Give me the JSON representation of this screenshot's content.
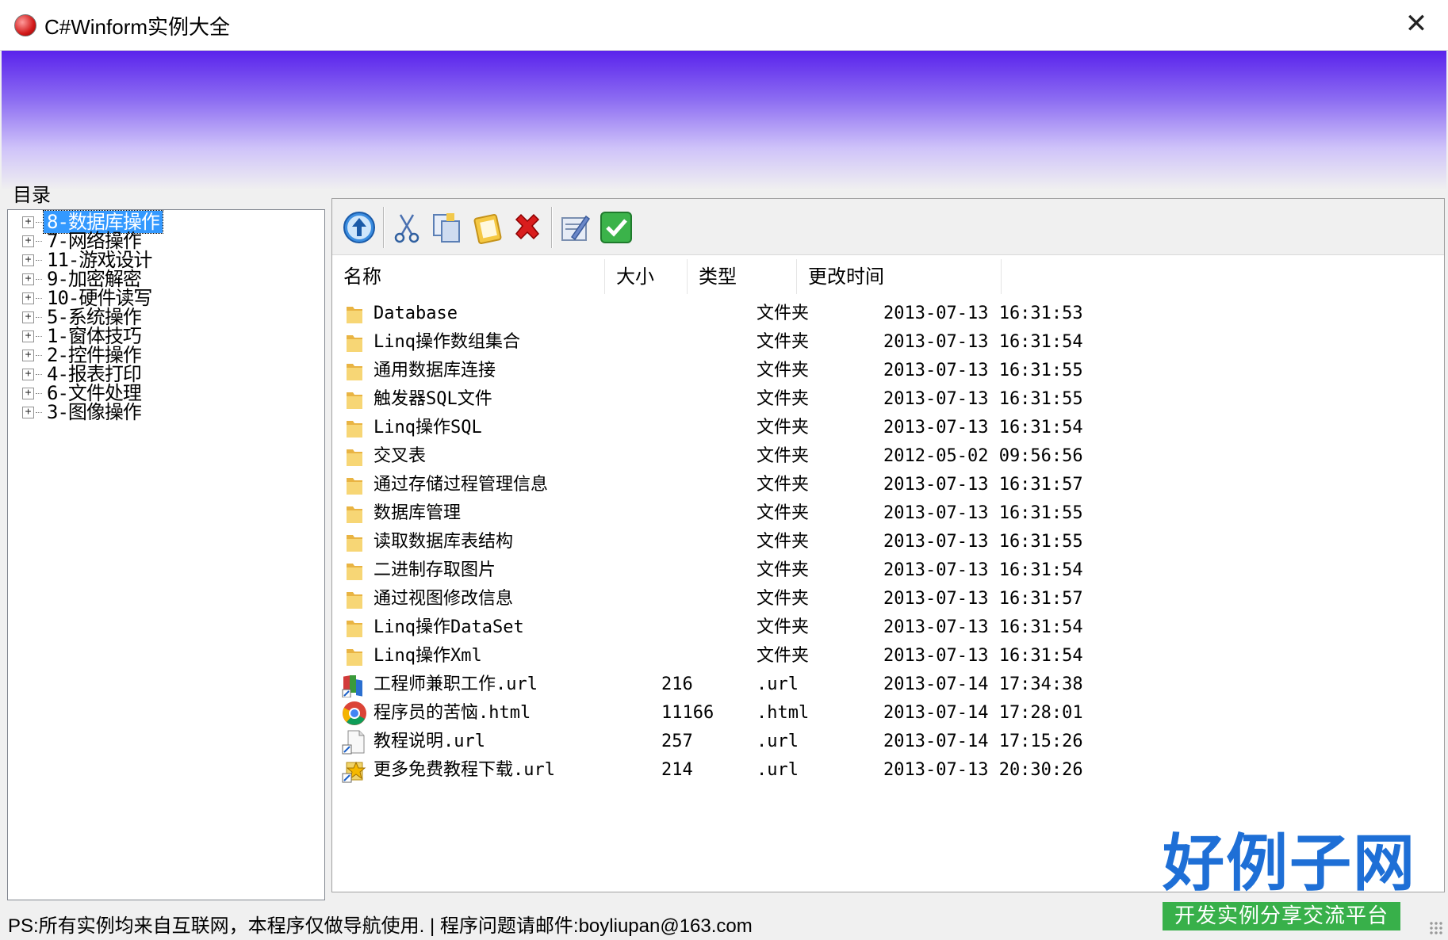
{
  "window": {
    "title": "C#Winform实例大全",
    "close_glyph": "✕"
  },
  "directory_label": "目录",
  "tree": [
    {
      "label": "8-数据库操作",
      "selected": true
    },
    {
      "label": "7-网络操作"
    },
    {
      "label": "11-游戏设计"
    },
    {
      "label": "9-加密解密"
    },
    {
      "label": "10-硬件读写"
    },
    {
      "label": "5-系统操作"
    },
    {
      "label": "1-窗体技巧"
    },
    {
      "label": "2-控件操作"
    },
    {
      "label": "4-报表打印"
    },
    {
      "label": "6-文件处理"
    },
    {
      "label": "3-图像操作"
    }
  ],
  "tree_expander_glyph": "+",
  "toolbar": {
    "buttons": [
      "up-icon",
      "cut-icon",
      "copy-icon",
      "paste-icon",
      "delete-icon",
      "rename-icon",
      "confirm-icon"
    ]
  },
  "list": {
    "columns": [
      "名称",
      "大小",
      "类型",
      "更改时间"
    ],
    "rows": [
      {
        "icon": "folder-icon",
        "name": "Database",
        "size": "",
        "type": "文件夹",
        "modified": "2013-07-13 16:31:53"
      },
      {
        "icon": "folder-icon",
        "name": "Linq操作数组集合",
        "size": "",
        "type": "文件夹",
        "modified": "2013-07-13 16:31:54"
      },
      {
        "icon": "folder-icon",
        "name": "通用数据库连接",
        "size": "",
        "type": "文件夹",
        "modified": "2013-07-13 16:31:55"
      },
      {
        "icon": "folder-icon",
        "name": "触发器SQL文件",
        "size": "",
        "type": "文件夹",
        "modified": "2013-07-13 16:31:55"
      },
      {
        "icon": "folder-icon",
        "name": "Linq操作SQL",
        "size": "",
        "type": "文件夹",
        "modified": "2013-07-13 16:31:54"
      },
      {
        "icon": "folder-icon",
        "name": "交叉表",
        "size": "",
        "type": "文件夹",
        "modified": "2012-05-02 09:56:56"
      },
      {
        "icon": "folder-icon",
        "name": "通过存储过程管理信息",
        "size": "",
        "type": "文件夹",
        "modified": "2013-07-13 16:31:57"
      },
      {
        "icon": "folder-icon",
        "name": "数据库管理",
        "size": "",
        "type": "文件夹",
        "modified": "2013-07-13 16:31:55"
      },
      {
        "icon": "folder-icon",
        "name": "读取数据库表结构",
        "size": "",
        "type": "文件夹",
        "modified": "2013-07-13 16:31:55"
      },
      {
        "icon": "folder-icon",
        "name": "二进制存取图片",
        "size": "",
        "type": "文件夹",
        "modified": "2013-07-13 16:31:54"
      },
      {
        "icon": "folder-icon",
        "name": "通过视图修改信息",
        "size": "",
        "type": "文件夹",
        "modified": "2013-07-13 16:31:57"
      },
      {
        "icon": "folder-icon",
        "name": "Linq操作DataSet",
        "size": "",
        "type": "文件夹",
        "modified": "2013-07-13 16:31:54"
      },
      {
        "icon": "folder-icon",
        "name": "Linq操作Xml",
        "size": "",
        "type": "文件夹",
        "modified": "2013-07-13 16:31:54"
      },
      {
        "icon": "url-shortcut-icon",
        "name": "工程师兼职工作.url",
        "size": "216",
        "type": ".url",
        "modified": "2013-07-14 17:34:38"
      },
      {
        "icon": "chrome-icon",
        "name": "程序员的苦恼.html",
        "size": "11166",
        "type": ".html",
        "modified": "2013-07-14 17:28:01"
      },
      {
        "icon": "document-shortcut-icon",
        "name": "教程说明.url",
        "size": "257",
        "type": ".url",
        "modified": "2013-07-14 17:15:26"
      },
      {
        "icon": "star-shortcut-icon",
        "name": "更多免费教程下载.url",
        "size": "214",
        "type": ".url",
        "modified": "2013-07-13 20:30:26"
      }
    ]
  },
  "status": {
    "text": "PS:所有实例均来自互联网，本程序仅做导航使用. | 程序问题请邮件:boyliupan@163.com"
  },
  "logo": {
    "main": "好例子网",
    "sub": "开发实例分享交流平台"
  },
  "colors": {
    "banner_top": "#5a23ec",
    "selection": "#3399ff",
    "logo_blue": "#1e6fd6",
    "logo_green": "#38b04a"
  }
}
